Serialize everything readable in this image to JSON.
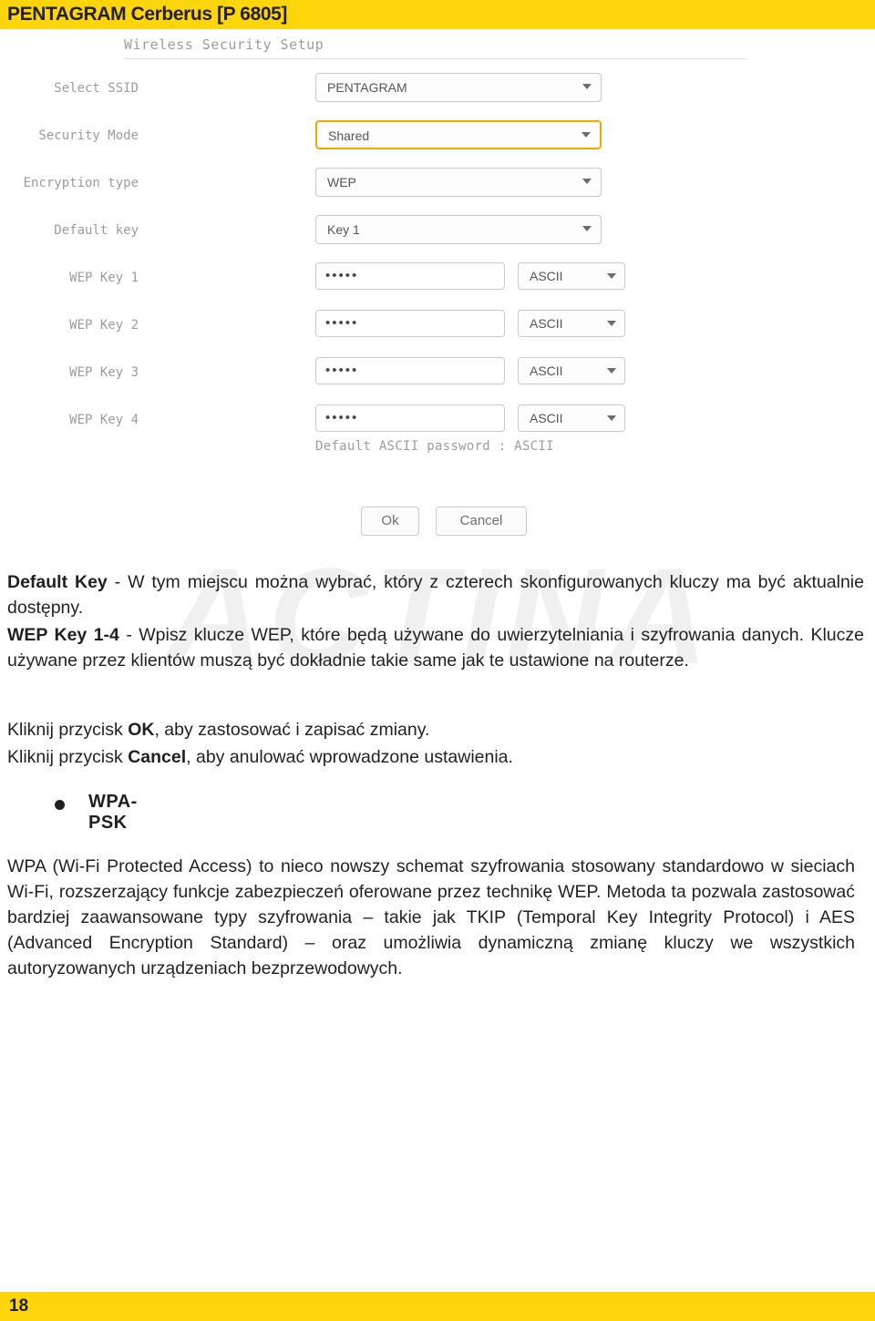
{
  "header": {
    "title": "PENTAGRAM Cerberus [P 6805]"
  },
  "footer": {
    "page_number": "18"
  },
  "watermark": {
    "text": "ACTINA"
  },
  "screenshot": {
    "panel_title": "Wireless Security Setup",
    "rows": [
      {
        "label": "Select SSID",
        "value": "PENTAGRAM"
      },
      {
        "label": "Security Mode",
        "value": "Shared"
      },
      {
        "label": "Encryption type",
        "value": "WEP"
      },
      {
        "label": "Default key",
        "value": "Key 1"
      }
    ],
    "wep_keys": [
      {
        "label": "WEP Key 1",
        "value": "•••••",
        "encoding": "ASCII"
      },
      {
        "label": "WEP Key 2",
        "value": "•••••",
        "encoding": "ASCII"
      },
      {
        "label": "WEP Key 3",
        "value": "•••••",
        "encoding": "ASCII"
      },
      {
        "label": "WEP Key 4",
        "value": "•••••",
        "encoding": "ASCII"
      }
    ],
    "default_password_note": "Default ASCII password : ASCII",
    "ok_button": "Ok",
    "cancel_button": "Cancel"
  },
  "content": {
    "p1_term": "Default Key",
    "p1_text": " - W tym miejscu można wybrać, który z czterech skonfigurowanych kluczy ma być aktualnie dostępny.",
    "p2_term": "WEP Key 1-4",
    "p2_text": " - Wpisz klucze WEP, które będą używane do uwierzytelniania i szyfrowania danych. Klucze używane przez klientów muszą być dokładnie takie same jak te ustawione na routerze.",
    "p3_pre": "Kliknij przycisk ",
    "p3_term": "OK",
    "p3_post": ", aby zastosować i zapisać zmiany.",
    "p4_pre": "Kliknij przycisk ",
    "p4_term": "Cancel",
    "p4_post": ", aby anulować wprowadzone ustawienia.",
    "bullet_label": "WPA-PSK",
    "p5_text": "WPA (Wi-Fi Protected Access) to nieco nowszy schemat szyfrowania stosowany standardowo w sieciach Wi-Fi, rozszerzający funkcje zabezpieczeń oferowane przez technikę WEP. Metoda ta pozwala zastosować bardziej zaawansowane typy szyfrowania – takie jak TKIP (Temporal Key Integrity Protocol) i AES (Advanced Encryption Standard) – oraz umożliwia dynamiczną zmianę kluczy we wszystkich autoryzowanych urządzeniach bezprzewodowych."
  },
  "colors": {
    "brand_yellow": "#fcd50a",
    "ink": "#231f20",
    "highlight_border": "#f0a800"
  }
}
